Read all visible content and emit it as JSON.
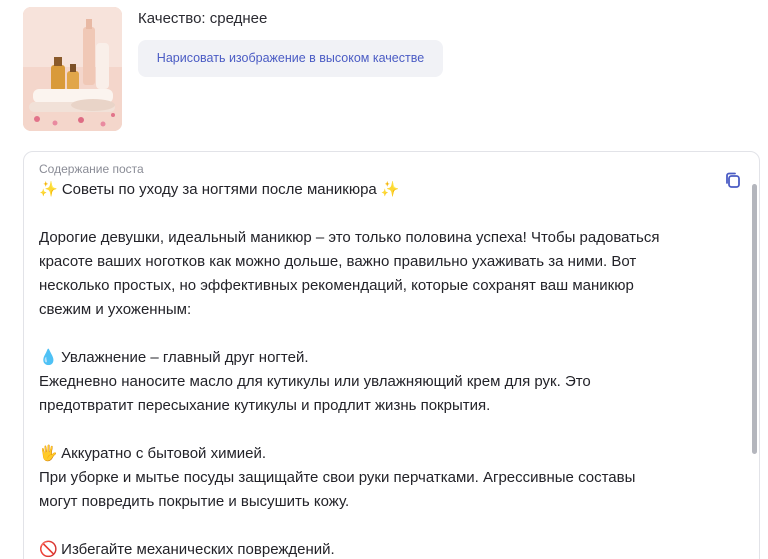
{
  "header": {
    "quality_label": "Качество: среднее",
    "hq_button_label": "Нарисовать изображение в высоком качестве"
  },
  "post": {
    "section_label": "Содержание поста",
    "title": "✨ Советы по уходу за ногтями после маникюра ✨",
    "intro_lines": [
      "Дорогие девушки, идеальный маникюр – это только половина успеха! Чтобы радоваться",
      "красоте ваших ноготков как можно дольше, важно правильно ухаживать за ними. Вот",
      "несколько простых, но эффективных рекомендаций, которые сохранят ваш маникюр",
      "свежим и ухоженным:"
    ],
    "tip1": {
      "icon": "💧",
      "icon_name": "droplet-icon",
      "heading": "Увлажнение – главный друг ногтей.",
      "lines": [
        "Ежедневно наносите масло для кутикулы или увлажняющий крем для рук. Это",
        "предотвратит пересыхание кутикулы и продлит жизнь покрытия."
      ]
    },
    "tip2": {
      "icon": "🖐",
      "icon_name": "raised-hand-icon",
      "heading": "Аккуратно с бытовой химией.",
      "lines": [
        "При уборке и мытье посуды защищайте свои руки перчатками. Агрессивные составы",
        "могут повредить покрытие и высушить кожу."
      ]
    },
    "tip3": {
      "icon": "🚫",
      "icon_name": "prohibited-icon",
      "heading": "Избегайте механических повреждений."
    }
  },
  "colors": {
    "accent": "#4b5cc4",
    "button_bg": "#f1f2f6",
    "muted_text": "#8a8c96",
    "border": "#e2e3e8"
  }
}
